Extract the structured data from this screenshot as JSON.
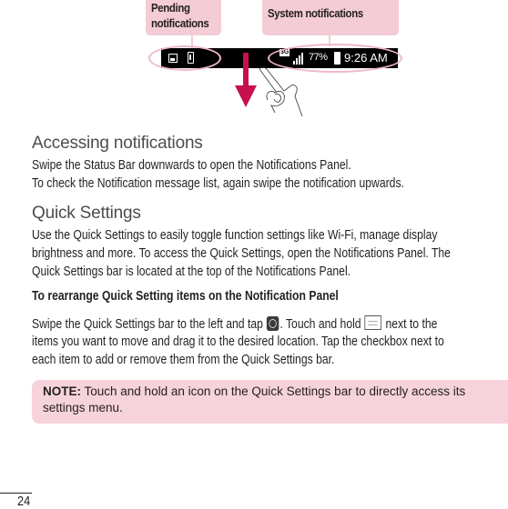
{
  "illustration": {
    "callout_pending": [
      "Pending",
      "notifications"
    ],
    "callout_system": "System notifications",
    "status_bar": {
      "left_icons": [
        "image-icon",
        "usb-battery-icon"
      ],
      "network_badge": "3G",
      "signal": "signal-bars-icon",
      "battery_percent": "77%",
      "battery_icon": "battery-icon",
      "time": "9:26 AM"
    },
    "gesture": "swipe-down",
    "accent_colors": {
      "arrow": "#c8104e",
      "callout_bg": "#f4ccd6",
      "oval": "#f0b8c6"
    }
  },
  "section_notifications": {
    "heading": "Accessing notifications",
    "lines": [
      "Swipe the Status Bar downwards to open the Notifications Panel.",
      "To check the Notification message list, again swipe the notification upwards."
    ]
  },
  "section_quick_settings": {
    "heading": "Quick Settings",
    "lines": [
      "Use the Quick Settings to easily toggle function settings like Wi-Fi, manage display",
      "brightness and more. To access the Quick Settings, open the Notifications Panel. The",
      "Quick Settings bar is located at the top of the Notifications Panel."
    ],
    "subheading": "To rearrange Quick Setting items on the Notification Panel",
    "instructions": {
      "line1_a": "Swipe the Quick Settings bar to the left and tap",
      "line1_b": ". Touch and hold",
      "line1_c": "next to the",
      "line2": "items you want to move and drag it to the desired location. Tap the checkbox next to",
      "line3": "each item to add or remove them from the Quick Settings bar."
    }
  },
  "note": {
    "label": "NOTE:",
    "text": " Touch and hold an icon on the Quick Settings bar to directly access its settings menu."
  },
  "page_number": "24"
}
